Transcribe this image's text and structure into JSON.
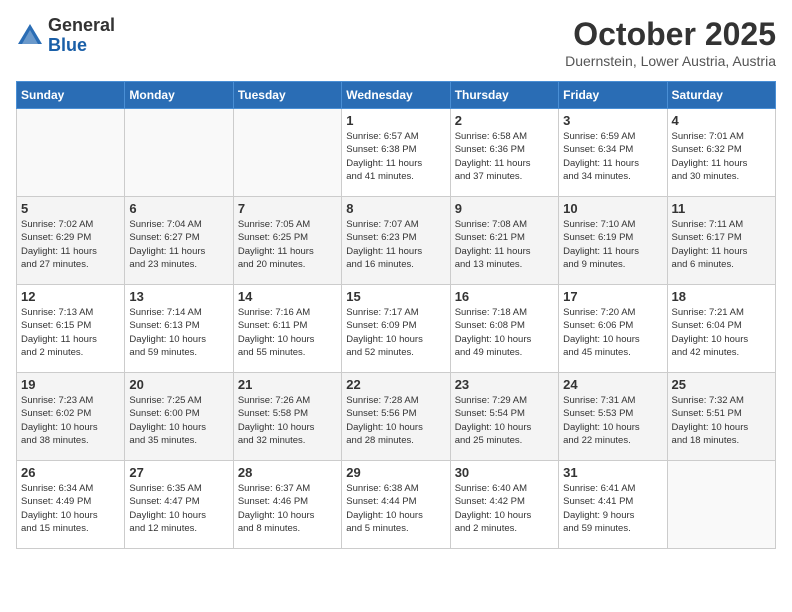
{
  "header": {
    "logo_general": "General",
    "logo_blue": "Blue",
    "month_title": "October 2025",
    "location": "Duernstein, Lower Austria, Austria"
  },
  "weekdays": [
    "Sunday",
    "Monday",
    "Tuesday",
    "Wednesday",
    "Thursday",
    "Friday",
    "Saturday"
  ],
  "weeks": [
    [
      {
        "day": "",
        "info": ""
      },
      {
        "day": "",
        "info": ""
      },
      {
        "day": "",
        "info": ""
      },
      {
        "day": "1",
        "info": "Sunrise: 6:57 AM\nSunset: 6:38 PM\nDaylight: 11 hours\nand 41 minutes."
      },
      {
        "day": "2",
        "info": "Sunrise: 6:58 AM\nSunset: 6:36 PM\nDaylight: 11 hours\nand 37 minutes."
      },
      {
        "day": "3",
        "info": "Sunrise: 6:59 AM\nSunset: 6:34 PM\nDaylight: 11 hours\nand 34 minutes."
      },
      {
        "day": "4",
        "info": "Sunrise: 7:01 AM\nSunset: 6:32 PM\nDaylight: 11 hours\nand 30 minutes."
      }
    ],
    [
      {
        "day": "5",
        "info": "Sunrise: 7:02 AM\nSunset: 6:29 PM\nDaylight: 11 hours\nand 27 minutes."
      },
      {
        "day": "6",
        "info": "Sunrise: 7:04 AM\nSunset: 6:27 PM\nDaylight: 11 hours\nand 23 minutes."
      },
      {
        "day": "7",
        "info": "Sunrise: 7:05 AM\nSunset: 6:25 PM\nDaylight: 11 hours\nand 20 minutes."
      },
      {
        "day": "8",
        "info": "Sunrise: 7:07 AM\nSunset: 6:23 PM\nDaylight: 11 hours\nand 16 minutes."
      },
      {
        "day": "9",
        "info": "Sunrise: 7:08 AM\nSunset: 6:21 PM\nDaylight: 11 hours\nand 13 minutes."
      },
      {
        "day": "10",
        "info": "Sunrise: 7:10 AM\nSunset: 6:19 PM\nDaylight: 11 hours\nand 9 minutes."
      },
      {
        "day": "11",
        "info": "Sunrise: 7:11 AM\nSunset: 6:17 PM\nDaylight: 11 hours\nand 6 minutes."
      }
    ],
    [
      {
        "day": "12",
        "info": "Sunrise: 7:13 AM\nSunset: 6:15 PM\nDaylight: 11 hours\nand 2 minutes."
      },
      {
        "day": "13",
        "info": "Sunrise: 7:14 AM\nSunset: 6:13 PM\nDaylight: 10 hours\nand 59 minutes."
      },
      {
        "day": "14",
        "info": "Sunrise: 7:16 AM\nSunset: 6:11 PM\nDaylight: 10 hours\nand 55 minutes."
      },
      {
        "day": "15",
        "info": "Sunrise: 7:17 AM\nSunset: 6:09 PM\nDaylight: 10 hours\nand 52 minutes."
      },
      {
        "day": "16",
        "info": "Sunrise: 7:18 AM\nSunset: 6:08 PM\nDaylight: 10 hours\nand 49 minutes."
      },
      {
        "day": "17",
        "info": "Sunrise: 7:20 AM\nSunset: 6:06 PM\nDaylight: 10 hours\nand 45 minutes."
      },
      {
        "day": "18",
        "info": "Sunrise: 7:21 AM\nSunset: 6:04 PM\nDaylight: 10 hours\nand 42 minutes."
      }
    ],
    [
      {
        "day": "19",
        "info": "Sunrise: 7:23 AM\nSunset: 6:02 PM\nDaylight: 10 hours\nand 38 minutes."
      },
      {
        "day": "20",
        "info": "Sunrise: 7:25 AM\nSunset: 6:00 PM\nDaylight: 10 hours\nand 35 minutes."
      },
      {
        "day": "21",
        "info": "Sunrise: 7:26 AM\nSunset: 5:58 PM\nDaylight: 10 hours\nand 32 minutes."
      },
      {
        "day": "22",
        "info": "Sunrise: 7:28 AM\nSunset: 5:56 PM\nDaylight: 10 hours\nand 28 minutes."
      },
      {
        "day": "23",
        "info": "Sunrise: 7:29 AM\nSunset: 5:54 PM\nDaylight: 10 hours\nand 25 minutes."
      },
      {
        "day": "24",
        "info": "Sunrise: 7:31 AM\nSunset: 5:53 PM\nDaylight: 10 hours\nand 22 minutes."
      },
      {
        "day": "25",
        "info": "Sunrise: 7:32 AM\nSunset: 5:51 PM\nDaylight: 10 hours\nand 18 minutes."
      }
    ],
    [
      {
        "day": "26",
        "info": "Sunrise: 6:34 AM\nSunset: 4:49 PM\nDaylight: 10 hours\nand 15 minutes."
      },
      {
        "day": "27",
        "info": "Sunrise: 6:35 AM\nSunset: 4:47 PM\nDaylight: 10 hours\nand 12 minutes."
      },
      {
        "day": "28",
        "info": "Sunrise: 6:37 AM\nSunset: 4:46 PM\nDaylight: 10 hours\nand 8 minutes."
      },
      {
        "day": "29",
        "info": "Sunrise: 6:38 AM\nSunset: 4:44 PM\nDaylight: 10 hours\nand 5 minutes."
      },
      {
        "day": "30",
        "info": "Sunrise: 6:40 AM\nSunset: 4:42 PM\nDaylight: 10 hours\nand 2 minutes."
      },
      {
        "day": "31",
        "info": "Sunrise: 6:41 AM\nSunset: 4:41 PM\nDaylight: 9 hours\nand 59 minutes."
      },
      {
        "day": "",
        "info": ""
      }
    ]
  ]
}
